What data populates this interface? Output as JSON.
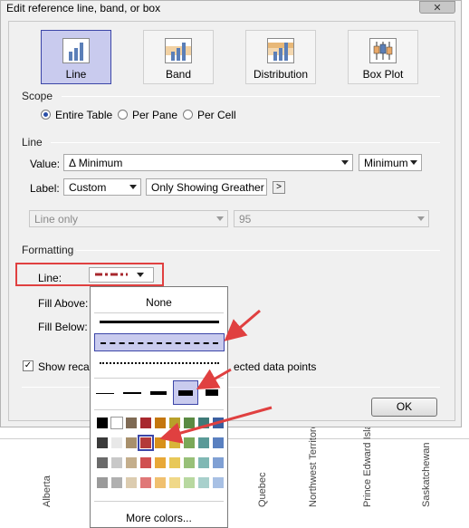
{
  "window": {
    "title": "Edit reference line, band, or box",
    "close_glyph": "✕"
  },
  "types": [
    {
      "label": "Line",
      "selected": true
    },
    {
      "label": "Band",
      "selected": false
    },
    {
      "label": "Distribution",
      "selected": false
    },
    {
      "label": "Box Plot",
      "selected": false
    }
  ],
  "scope": {
    "heading": "Scope",
    "options": [
      "Entire Table",
      "Per Pane",
      "Per Cell"
    ],
    "selected": "Entire Table"
  },
  "line_section": {
    "heading": "Line",
    "value_label": "Value:",
    "value_field": "Δ Minimum",
    "aggregation": "Minimum",
    "label_label": "Label:",
    "label_mode": "Custom",
    "label_text": "Only Showing Greather Tha",
    "insert_button": ">",
    "display_mode": "Line only",
    "confidence": "95"
  },
  "formatting": {
    "heading": "Formatting",
    "line_label": "Line:",
    "fill_above_label": "Fill Above:",
    "fill_below_label": "Fill Below:",
    "line_color": "#a8282e"
  },
  "recalc_checkbox": {
    "label_start": "Show recalc",
    "label_end": "ected data points",
    "checked": true
  },
  "ok_label": "OK",
  "popup": {
    "none_label": "None",
    "more_colors_label": "More colors...",
    "selected_style": "dashed",
    "selected_weight": 4,
    "swatch_rows": [
      [
        "#000000",
        "#ffffff",
        "#7f6a54",
        "#a8282e",
        "#c4760e",
        "#b8a02a",
        "#5a8a42",
        "#3f7a78",
        "#3a5fa0",
        "#5a5aa0"
      ],
      [
        "#3a3a3a",
        "#e8e8e8",
        "#a8906c",
        "#b43a3a",
        "#d8901a",
        "#d8b43a",
        "#7aa858",
        "#5a9a98",
        "#5a80c0",
        "#7a7ab8"
      ],
      [
        "#6a6a6a",
        "#c8c8c8",
        "#c4ae8c",
        "#d05050",
        "#e8a838",
        "#e8c858",
        "#98c078",
        "#80b8b4",
        "#80a0d4",
        "#9a9ac8"
      ],
      [
        "#9a9a9a",
        "#b0b0b0",
        "#dcccb0",
        "#e07878",
        "#f0c070",
        "#f0d888",
        "#b8d8a0",
        "#a8d0cc",
        "#a8c0e4",
        "#bcbcdc"
      ]
    ],
    "selected_swatch": [
      1,
      3
    ]
  },
  "background_labels": [
    "Alberta",
    "Quebec",
    "Northwest Territores",
    "Prince Edward Island",
    "Saskatchewan"
  ]
}
